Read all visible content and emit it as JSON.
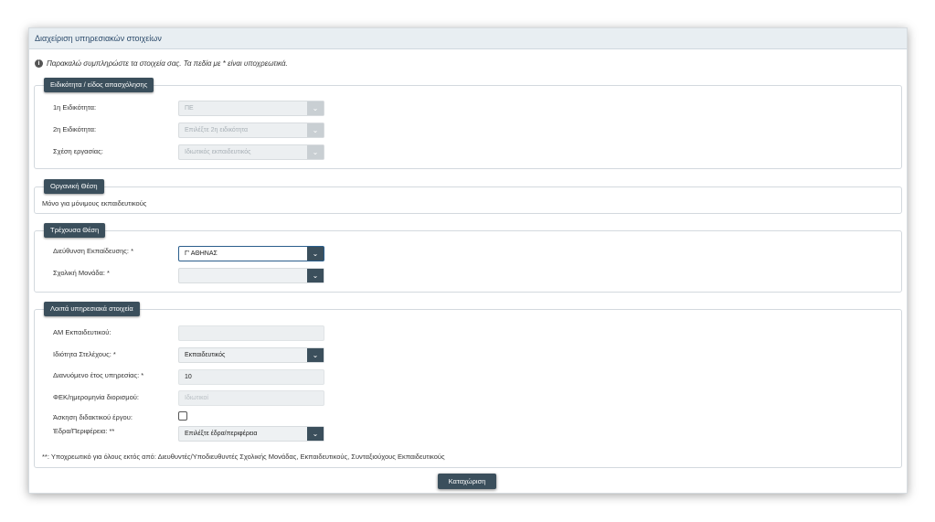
{
  "header": {
    "title": "Διαχείριση υπηρεσιακών στοιχείων"
  },
  "info": {
    "icon": "info-icon",
    "text": "Παρακαλώ συμπληρώστε τα στοιχεία σας. Τα πεδία με * είναι υποχρεωτικά."
  },
  "specialty": {
    "legend": "Ειδικότητα / είδος απασχόλησης",
    "specialty1_label": "1η Ειδικότητα:",
    "specialty1_value": "ΠΕ",
    "specialty2_label": "2η Ειδικότητα:",
    "specialty2_value": "Επιλέξτε 2η ειδικότητα",
    "relation_label": "Σχέση εργασίας:",
    "relation_value": "Ιδιωτικός εκπαιδευτικός"
  },
  "organic": {
    "legend": "Οργανική Θέση",
    "text": "Μόνο για μόνιμους εκπαιδευτικούς"
  },
  "current": {
    "legend": "Τρέχουσα Θέση",
    "directorate_label": "Διεύθυνση Εκπαίδευσης:",
    "directorate_value": "Γ' ΑΘΗΝΑΣ",
    "school_label": "Σχολική Μονάδα:",
    "school_value": ""
  },
  "other": {
    "legend": "Λοιπά υπηρεσιακά στοιχεία",
    "am_label": "ΑΜ Εκπαιδευτικού:",
    "am_value": "",
    "role_label": "Ιδιότητα Στελέχους:",
    "role_value": "Εκπαιδευτικός",
    "year_label": "Διανυόμενο έτος υπηρεσίας:",
    "year_value": "10",
    "fek_label": "ΦΕΚ/ημερομηνία διορισμού:",
    "fek_placeholder": "Ιδιωτικοί",
    "teaching_label": "Άσκηση διδακτικού έργου:",
    "seat_label": "Έδρα/Περιφέρεια:",
    "seat_value": "Επιλέξτε έδρα/περιφέρεια",
    "footnote": "**: Υποχρεωτικό για όλους εκτός από: Διευθυντές/Υποδιευθυντές Σχολικής Μονάδας, Εκπαιδευτικούς, Συνταξιούχους Εκπαιδευτικούς"
  },
  "required_mark": "*",
  "double_required_mark": "**",
  "submit_label": "Καταχώριση",
  "colors": {
    "button": "#3b4f5c",
    "header_bg": "#e8eef2",
    "title": "#2c4b6b"
  }
}
